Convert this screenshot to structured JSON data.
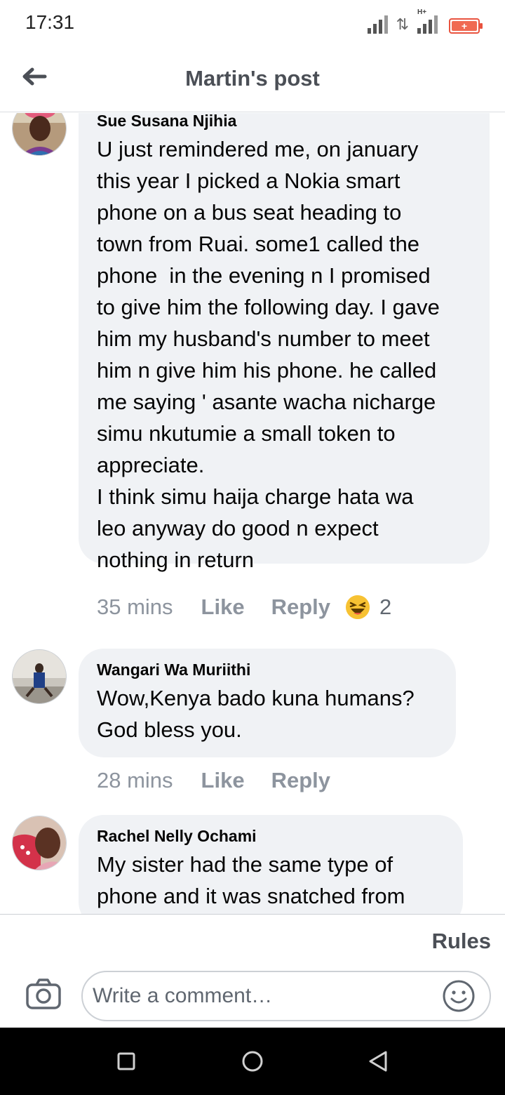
{
  "status": {
    "time": "17:31",
    "network": "H+",
    "battery_label": "+",
    "battery_color": "#e9533f"
  },
  "header": {
    "title": "Martin's post",
    "back_icon": "back-arrow-icon"
  },
  "comments": [
    {
      "author": "Sue Susana Njihia",
      "text": "U just remindered me, on january\nthis year I picked a Nokia smart\nphone on a bus seat heading to\ntown from Ruai. some1 called the\nphone  in the evening n I promised\nto give him the following day. I gave\nhim my husband's number to meet\nhim n give him his phone. he called\nme saying ' asante wacha nicharge\nsimu nkutumie a small token to\nappreciate.\nI think simu haija charge hata wa\nleo anyway do good n expect\nnothing in return",
      "time": "35 mins",
      "like_label": "Like",
      "reply_label": "Reply",
      "reaction_icon": "haha-emoji-icon",
      "reaction_count": "2"
    },
    {
      "author": "Wangari Wa Muriithi",
      "text": "Wow,Kenya bado kuna humans?\nGod bless you.",
      "time": "28 mins",
      "like_label": "Like",
      "reply_label": "Reply"
    },
    {
      "author": "Rachel Nelly Ochami",
      "text": "My sister had the same type of\nphone and it was snatched from"
    }
  ],
  "composer": {
    "rules_label": "Rules",
    "placeholder": "Write a comment…",
    "camera_icon": "camera-icon",
    "emoji_icon": "smiley-icon"
  },
  "navbar": {
    "icons": [
      "square-recents-icon",
      "circle-home-icon",
      "triangle-back-icon"
    ]
  },
  "colors": {
    "bubble": "#f0f2f5",
    "meta_text": "#8d949e",
    "header_text": "#4b4f56"
  }
}
